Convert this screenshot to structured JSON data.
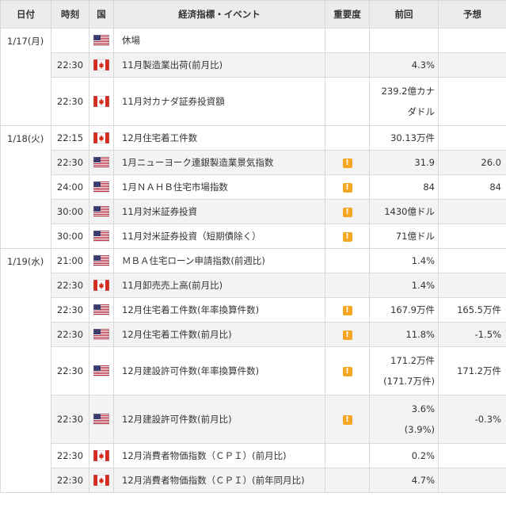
{
  "headers": {
    "date": "日付",
    "time": "時刻",
    "country": "国",
    "event": "経済指標・イベント",
    "importance": "重要度",
    "previous": "前回",
    "forecast": "予想"
  },
  "icons": {
    "us": "us-flag-icon",
    "ca": "canada-flag-icon",
    "importance": "exclamation-badge-icon"
  },
  "colors": {
    "importance_badge": "#f5a623",
    "canada_red": "#d52b1e",
    "us_blue": "#3c3b6e",
    "us_red": "#b22234"
  },
  "groups": [
    {
      "date": "1/17(月)",
      "rows": [
        {
          "time": "",
          "country": "us",
          "event": "休場",
          "important": false,
          "prev": [],
          "forecast": ""
        },
        {
          "time": "22:30",
          "country": "ca",
          "event": "11月製造業出荷(前月比)",
          "important": false,
          "prev": [
            "4.3%"
          ],
          "forecast": ""
        },
        {
          "time": "22:30",
          "country": "ca",
          "event": "11月対カナダ証券投資額",
          "important": false,
          "prev": [
            "239.2億カナ",
            "ダドル"
          ],
          "forecast": ""
        }
      ]
    },
    {
      "date": "1/18(火)",
      "rows": [
        {
          "time": "22:15",
          "country": "ca",
          "event": "12月住宅着工件数",
          "important": false,
          "prev": [
            "30.13万件"
          ],
          "forecast": ""
        },
        {
          "time": "22:30",
          "country": "us",
          "event": "1月ニューヨーク連銀製造業景気指数",
          "important": true,
          "prev": [
            "31.9"
          ],
          "forecast": "26.0"
        },
        {
          "time": "24:00",
          "country": "us",
          "event": "1月ＮＡＨＢ住宅市場指数",
          "important": true,
          "prev": [
            "84"
          ],
          "forecast": "84"
        },
        {
          "time": "30:00",
          "country": "us",
          "event": "11月対米証券投資",
          "important": true,
          "prev": [
            "1430億ドル"
          ],
          "forecast": ""
        },
        {
          "time": "30:00",
          "country": "us",
          "event": "11月対米証券投資（短期債除く）",
          "important": true,
          "prev": [
            "71億ドル"
          ],
          "forecast": ""
        }
      ]
    },
    {
      "date": "1/19(水)",
      "rows": [
        {
          "time": "21:00",
          "country": "us",
          "event": "ＭＢＡ住宅ローン申請指数(前週比)",
          "important": false,
          "prev": [
            "1.4%"
          ],
          "forecast": ""
        },
        {
          "time": "22:30",
          "country": "ca",
          "event": "11月卸売売上高(前月比)",
          "important": false,
          "prev": [
            "1.4%"
          ],
          "forecast": ""
        },
        {
          "time": "22:30",
          "country": "us",
          "event": "12月住宅着工件数(年率換算件数)",
          "important": true,
          "prev": [
            "167.9万件"
          ],
          "forecast": "165.5万件"
        },
        {
          "time": "22:30",
          "country": "us",
          "event": "12月住宅着工件数(前月比)",
          "important": true,
          "prev": [
            "11.8%"
          ],
          "forecast": "-1.5%"
        },
        {
          "time": "22:30",
          "country": "us",
          "event": "12月建設許可件数(年率換算件数)",
          "important": true,
          "prev": [
            "171.2万件",
            "(171.7万件)"
          ],
          "forecast": "171.2万件"
        },
        {
          "time": "22:30",
          "country": "us",
          "event": "12月建設許可件数(前月比)",
          "important": true,
          "prev": [
            "3.6%",
            "(3.9%)"
          ],
          "forecast": "-0.3%"
        },
        {
          "time": "22:30",
          "country": "ca",
          "event": "12月消費者物価指数（ＣＰＩ）(前月比)",
          "important": false,
          "prev": [
            "0.2%"
          ],
          "forecast": ""
        },
        {
          "time": "22:30",
          "country": "ca",
          "event": "12月消費者物価指数（ＣＰＩ）(前年同月比)",
          "important": false,
          "prev": [
            "4.7%"
          ],
          "forecast": ""
        }
      ]
    }
  ]
}
